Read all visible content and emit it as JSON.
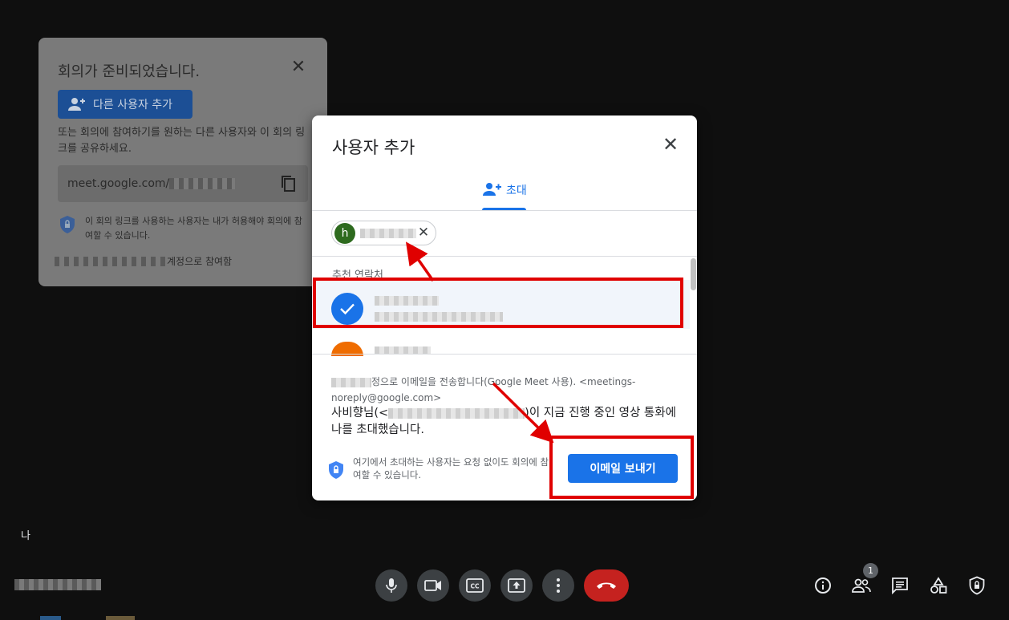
{
  "ready_panel": {
    "title": "회의가 준비되었습니다.",
    "add_button_label": "다른 사용자 추가",
    "description": "또는 회의에 참여하기를 원하는 다른 사용자와 이 회의 링크를 공유하세요.",
    "link_prefix": "meet.google.com/",
    "security_note": "이 회의 링크를 사용하는 사용자는 내가 허용해야 회의에 참여할 수 있습니다.",
    "account_suffix": "계정으로 참여함"
  },
  "dialog": {
    "title": "사용자 추가",
    "tab_invite": "초대",
    "chip_initial": "h",
    "suggested_label": "추천 연락처",
    "email_from_suffix": "정으로 이메일을 전송합니다(Google Meet 사용). <meetings-noreply@google.com>",
    "email_body_prefix": "사비향님(<",
    "email_body_suffix": ")이 지금 진행 중인 영상 통화에 나를 초대했습니다.",
    "footer_note": "여기에서 초대하는 사용자는 요청 없이도 회의에 참여할 수 있습니다.",
    "send_button": "이메일 보내기"
  },
  "bottom": {
    "self_label": "나",
    "participants_badge": "1"
  },
  "colors": {
    "accent": "#1a73e8",
    "end_call": "#c5221f",
    "annotation": "#e00000"
  }
}
